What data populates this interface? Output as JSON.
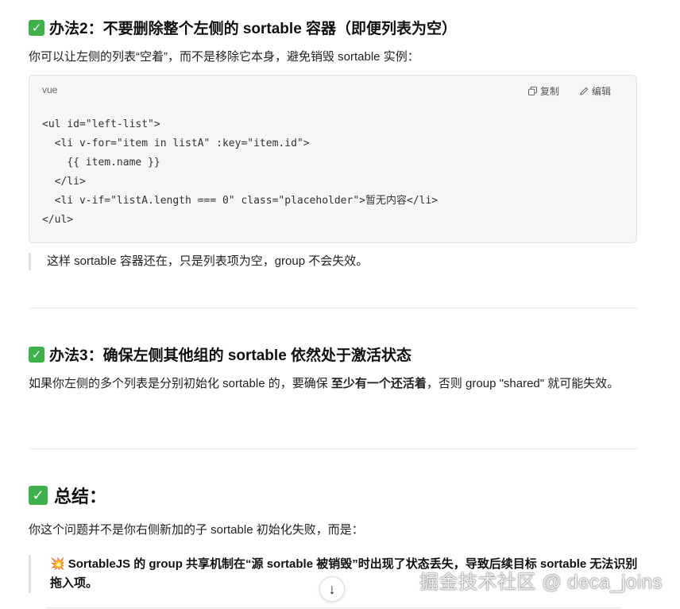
{
  "section2": {
    "heading": "办法2：不要删除整个左侧的 sortable 容器（即便列表为空）",
    "intro": "你可以让左侧的列表“空着”，而不是移除它本身，避免销毁 sortable 实例：",
    "code": {
      "lang": "vue",
      "copy_label": "复制",
      "edit_label": "编辑",
      "lines": [
        "<ul id=\"left-list\">",
        "  <li v-for=\"item in listA\" :key=\"item.id\">",
        "    {{ item.name }}",
        "  </li>",
        "  <li v-if=\"listA.length === 0\" class=\"placeholder\">暂无内容</li>",
        "</ul>"
      ]
    },
    "note": "这样 sortable 容器还在，只是列表项为空，group 不会失效。"
  },
  "section3": {
    "heading": "办法3：确保左侧其他组的 sortable 依然处于激活状态",
    "text_before": "如果你左侧的多个列表是分别初始化 sortable 的，要确保 ",
    "text_bold": "至少有一个还活着",
    "text_after": "，否则 group \"shared\" 就可能失效。"
  },
  "summary": {
    "heading": "总结：",
    "intro": "你这个问题并不是你右侧新加的子 sortable 初始化失败，而是：",
    "quote_emoji": "💥",
    "quote": "SortableJS 的 group 共享机制在“源 sortable 被销毁”时出现了状态丢失，导致后续目标 sortable 无法识别拖入项。"
  },
  "scroll_down_icon": "↓",
  "watermark": "掘金技术社区 @ deca_joins",
  "colors": {
    "check": "#3db249",
    "code_bg": "#f6f6f7"
  }
}
